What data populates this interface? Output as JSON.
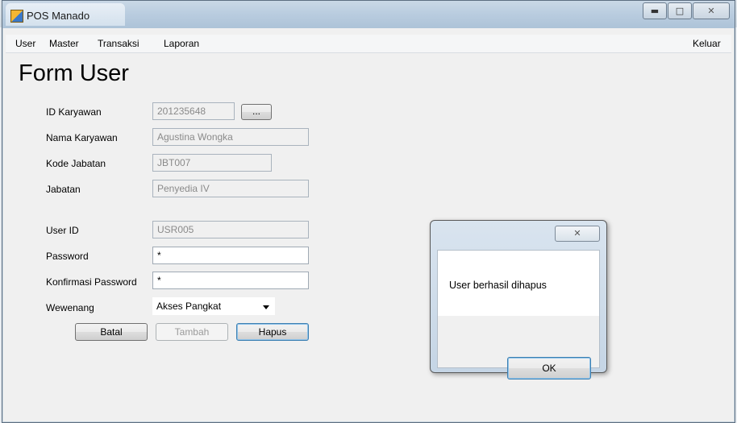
{
  "window": {
    "title": "POS Manado",
    "controls": [
      "minimize-icon",
      "maximize-icon",
      "close-icon"
    ]
  },
  "menu": {
    "items": [
      "User",
      "Master",
      "Transaksi",
      "Laporan"
    ],
    "right_item": "Keluar"
  },
  "form": {
    "title": "Form User",
    "employee": {
      "id_label": "ID Karyawan",
      "id_value": "201235648",
      "browse_label": "...",
      "name_label": "Nama Karyawan",
      "name_value": "Agustina Wongka",
      "position_code_label": "Kode Jabatan",
      "position_code_value": "JBT007",
      "position_label": "Jabatan",
      "position_value": "Penyedia IV"
    },
    "user": {
      "user_id_label": "User ID",
      "user_id_value": "USR005",
      "password_label": "Password",
      "password_value": "*",
      "confirm_label": "Konfirmasi Password",
      "confirm_value": "*",
      "role_label": "Wewenang",
      "role_value": "Akses Pangkat"
    },
    "buttons": {
      "cancel": "Batal",
      "add": "Tambah",
      "delete": "Hapus"
    }
  },
  "dialog": {
    "message": "User berhasil dihapus",
    "ok_label": "OK"
  }
}
